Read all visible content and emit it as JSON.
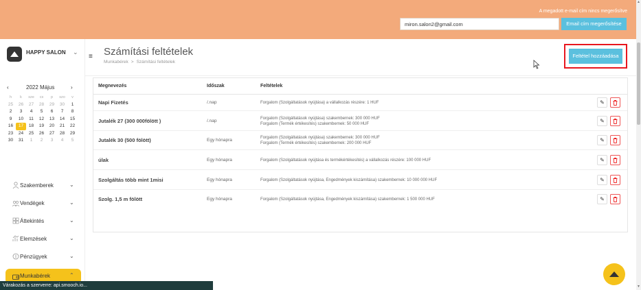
{
  "topbar": {
    "verify_message": "A megadott e-mail cím nincs megerősítve",
    "email_value": "miron.salon2@gmail.com",
    "verify_button": "Email cím megerősítése",
    "bg_color": "#f3aa7b"
  },
  "brand": {
    "name": "HAPPY SALON",
    "chevron": "⌄"
  },
  "calendar": {
    "prev": "‹",
    "title": "2022 Május",
    "next": "›",
    "dow": [
      "h",
      "k",
      "sze",
      "cs",
      "p",
      "szo",
      "v"
    ],
    "weeks": [
      [
        {
          "d": "25",
          "dim": true
        },
        {
          "d": "26",
          "dim": true
        },
        {
          "d": "27",
          "dim": true
        },
        {
          "d": "28",
          "dim": true
        },
        {
          "d": "29",
          "dim": true
        },
        {
          "d": "30",
          "dim": true
        },
        {
          "d": "1"
        }
      ],
      [
        {
          "d": "2"
        },
        {
          "d": "3"
        },
        {
          "d": "4"
        },
        {
          "d": "5"
        },
        {
          "d": "6"
        },
        {
          "d": "7"
        },
        {
          "d": "8"
        }
      ],
      [
        {
          "d": "9"
        },
        {
          "d": "10"
        },
        {
          "d": "11"
        },
        {
          "d": "12"
        },
        {
          "d": "13"
        },
        {
          "d": "14"
        },
        {
          "d": "15"
        }
      ],
      [
        {
          "d": "16"
        },
        {
          "d": "17",
          "sel": true
        },
        {
          "d": "18"
        },
        {
          "d": "19"
        },
        {
          "d": "20"
        },
        {
          "d": "21"
        },
        {
          "d": "22"
        }
      ],
      [
        {
          "d": "23"
        },
        {
          "d": "24"
        },
        {
          "d": "25"
        },
        {
          "d": "26"
        },
        {
          "d": "27"
        },
        {
          "d": "28"
        },
        {
          "d": "29"
        }
      ],
      [
        {
          "d": "30"
        },
        {
          "d": "31"
        },
        {
          "d": "1",
          "dim": true
        },
        {
          "d": "2",
          "dim": true
        },
        {
          "d": "3",
          "dim": true
        },
        {
          "d": "4",
          "dim": true
        },
        {
          "d": "5",
          "dim": true
        }
      ]
    ]
  },
  "nav": [
    {
      "label": "Szakemberek",
      "icon": "user-icon",
      "name": "nav-item-szakemberek"
    },
    {
      "label": "Vendégek",
      "icon": "users-icon",
      "name": "nav-item-vendegek"
    },
    {
      "label": "Áttekintés",
      "icon": "grid-icon",
      "name": "nav-item-attekintes"
    },
    {
      "label": "Elemzések",
      "icon": "chart-icon",
      "name": "nav-item-elemzesek"
    },
    {
      "label": "Pénzügyek",
      "icon": "money-icon",
      "name": "nav-item-penzugyek"
    },
    {
      "label": "Munkabérek",
      "icon": "wallet-icon",
      "name": "nav-item-munkaberek",
      "active": true
    }
  ],
  "status_bar": "Várakozás a szerverre: api.smooch.io...",
  "page": {
    "title": "Számítási feltételek",
    "breadcrumb": [
      "Munkabérek",
      "Számítási feltételek"
    ],
    "breadcrumb_sep": ">",
    "add_button": "Feltétel hozzáadása"
  },
  "table": {
    "headers": {
      "name": "Megnevezés",
      "period": "Időszak",
      "conditions": "Feltételek"
    },
    "rows": [
      {
        "name": "Napi Fizetés",
        "period": "/.nap",
        "conditions": [
          "Forgalom (Szolgáltatások nyújtása) a vállalkozás részére: 1 HUF"
        ]
      },
      {
        "name": "Jutalék 27 (300 000fölött )",
        "period": "/.nap",
        "conditions": [
          "Forgalom (Szolgáltatások nyújtása) szakembernek: 300 000 HUF",
          "Forgalom (Termék értékesítés) szakembernek: 50 000 HUF"
        ]
      },
      {
        "name": "Jutalék 30 (500 fölött)",
        "period": "Egy hónapra",
        "conditions": [
          "Forgalom (Szolgáltatások nyújtása) szakembernek: 300 000 HUF",
          "Forgalom (Termék értékesítés) szakembernek: 200 000 HUF"
        ]
      },
      {
        "name": "úlak",
        "period": "Egy hónapra",
        "conditions": [
          "Forgalom (Szolgáltatások nyújtása és termékértékesítés) a vállalkozás részére: 100 000 HUF"
        ]
      },
      {
        "name": "Szolgáltás több mint 1misi",
        "period": "Egy hónapra",
        "conditions": [
          "Forgalom (Szolgáltatások nyújtása, Engedmények kiszámítása) szakembernek: 10 000 000 HUF"
        ]
      },
      {
        "name": "Szolg. 1,5 m fölött",
        "period": "Egy hónapra",
        "conditions": [
          "Forgalom (Szolgáltatások nyújtása, Engedmények kiszámítása) szakembernek: 1 500 000 HUF"
        ]
      }
    ]
  },
  "colors": {
    "accent": "#5bc0de",
    "highlight": "#f5c21b",
    "danger": "#e8161e"
  }
}
